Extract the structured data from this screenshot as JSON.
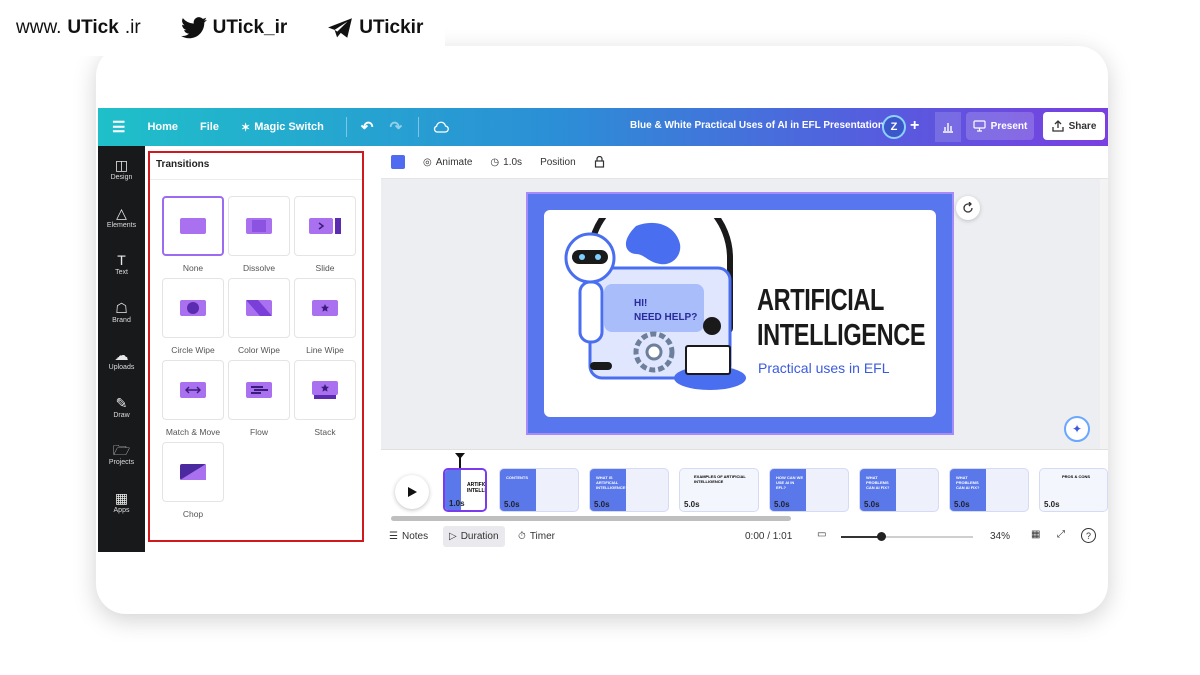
{
  "brand": {
    "website": "www.",
    "website_bold": "UTick",
    "website_tld": ".ir",
    "twitter": "UTick_ir",
    "telegram": "UTickir"
  },
  "topbar": {
    "menu_icon": "hamburger-icon",
    "home": "Home",
    "file": "File",
    "magic_switch": "Magic Switch",
    "doc_title": "Blue & White Practical Uses of AI in EFL Presentation",
    "avatar_letter": "Z",
    "present": "Present",
    "share": "Share"
  },
  "rail": {
    "items": [
      {
        "label": "Design",
        "icon": "layout-icon"
      },
      {
        "label": "Elements",
        "icon": "shapes-icon"
      },
      {
        "label": "Text",
        "icon": "text-icon"
      },
      {
        "label": "Brand",
        "icon": "brand-icon"
      },
      {
        "label": "Uploads",
        "icon": "upload-cloud-icon"
      },
      {
        "label": "Draw",
        "icon": "draw-icon"
      },
      {
        "label": "Projects",
        "icon": "folder-icon"
      },
      {
        "label": "Apps",
        "icon": "apps-grid-icon"
      }
    ]
  },
  "transitions": {
    "title": "Transitions",
    "items": [
      {
        "label": "None",
        "icon": "none-transition-icon",
        "selected": true
      },
      {
        "label": "Dissolve",
        "icon": "dissolve-transition-icon"
      },
      {
        "label": "Slide",
        "icon": "slide-transition-icon"
      },
      {
        "label": "Circle Wipe",
        "icon": "circle-wipe-transition-icon"
      },
      {
        "label": "Color Wipe",
        "icon": "color-wipe-transition-icon"
      },
      {
        "label": "Line Wipe",
        "icon": "line-wipe-transition-icon"
      },
      {
        "label": "Match & Move",
        "icon": "match-move-transition-icon"
      },
      {
        "label": "Flow",
        "icon": "flow-transition-icon"
      },
      {
        "label": "Stack",
        "icon": "stack-transition-icon"
      },
      {
        "label": "Chop",
        "icon": "chop-transition-icon"
      }
    ]
  },
  "canvas_toolbar": {
    "color": "#4f6cf0",
    "animate": "Animate",
    "duration": "1.0s",
    "position": "Position"
  },
  "slide": {
    "title_line1": "ARTIFICIAL",
    "title_line2": "INTELLIGENCE",
    "subtitle": "Practical uses in EFL",
    "bubble_line1": "HI!",
    "bubble_line2": "NEED HELP?"
  },
  "timeline": {
    "selected_label": "1.0s",
    "thumb_title": "ARTIFICI INTELLI",
    "slides": [
      {
        "duration": "5.0s",
        "title": "CONTENTS"
      },
      {
        "duration": "5.0s",
        "title": "WHAT IS ARTIFICIAL INTELLIGENCE?"
      },
      {
        "duration": "5.0s",
        "title": "EXAMPLES OF ARTIFICIAL INTELLIGENCE"
      },
      {
        "duration": "5.0s",
        "title": "HOW CAN WE USE AI IN EFL?"
      },
      {
        "duration": "5.0s",
        "title": "WHAT PROBLEMS CAN AI FIX?"
      },
      {
        "duration": "5.0s",
        "title": "WHAT PROBLEMS CAN AI FIX?"
      },
      {
        "duration": "5.0s",
        "title": "PROS & CONS"
      }
    ]
  },
  "bottombar": {
    "notes": "Notes",
    "duration": "Duration",
    "timer": "Timer",
    "time": "0:00 / 1:01",
    "zoom": "34%",
    "zoom_level": 0.3
  }
}
